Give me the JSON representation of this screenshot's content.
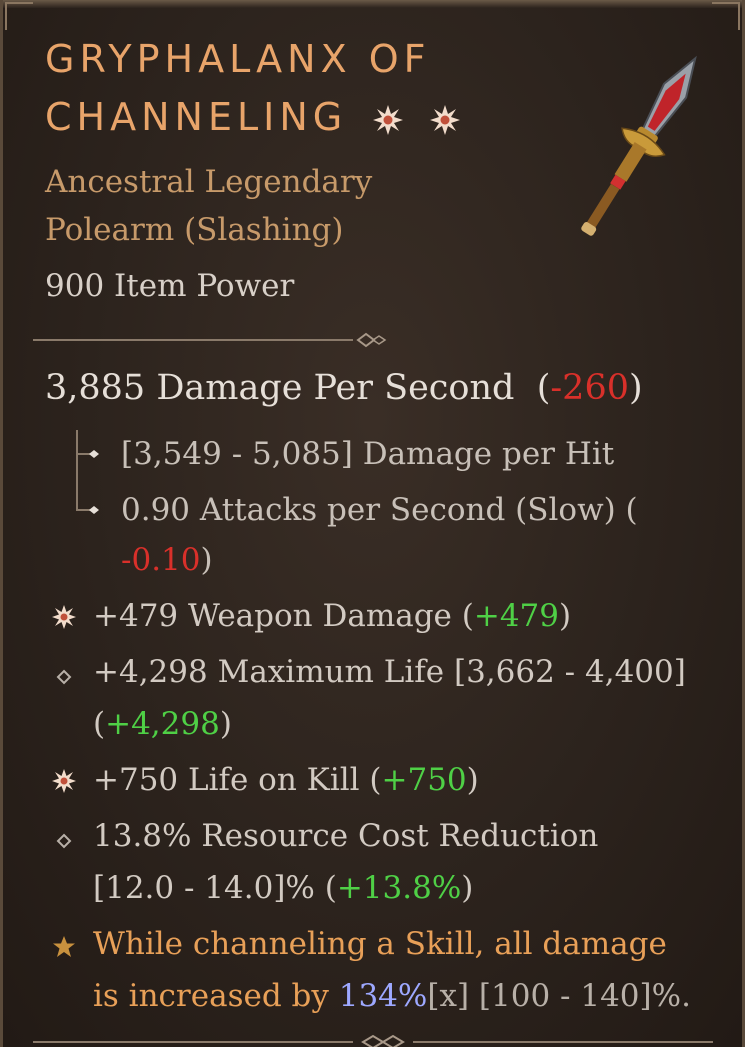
{
  "item": {
    "name_line1": "GRYPHALANX OF",
    "name_line2": "CHANNELING",
    "type_line1": "Ancestral Legendary",
    "type_line2": "Polearm (Slashing)",
    "item_power": "900 Item Power"
  },
  "stats": {
    "dps_text": "3,885 Damage Per Second",
    "dps_delta": "-260",
    "damage_per_hit": "[3,549 - 5,085] Damage per Hit",
    "attacks_text": "0.90 Attacks per Second (Slow) (",
    "attacks_delta": "-0.10",
    "close_paren": ")",
    "open_paren": "("
  },
  "affixes": [
    {
      "text": "+479 Weapon Damage",
      "delta": "+479",
      "icon": "greater-affix-star-icon"
    },
    {
      "text": "+4,298 Maximum Life [3,662 - 4,400]",
      "delta": "+4,298",
      "icon": "diamond-icon"
    },
    {
      "text": "+750 Life on Kill",
      "delta": "+750",
      "icon": "greater-affix-star-icon"
    },
    {
      "text": "13.8% Resource Cost Reduction",
      "range": "[12.0 - 14.0]%",
      "delta": "+13.8%",
      "icon": "diamond-icon"
    }
  ],
  "legendary": {
    "line1": "While channeling a Skill, all damage",
    "line2_prefix": "is increased by ",
    "value": "134%",
    "multiplier": "[x]",
    "range": " [100 - 140]%.",
    "icon": "legendary-star-icon"
  },
  "colors": {
    "title": "#e8a46a",
    "negative": "#d9302a",
    "positive": "#4fd046",
    "legendary_text": "#e8a058",
    "legendary_value": "#9da8ff"
  }
}
